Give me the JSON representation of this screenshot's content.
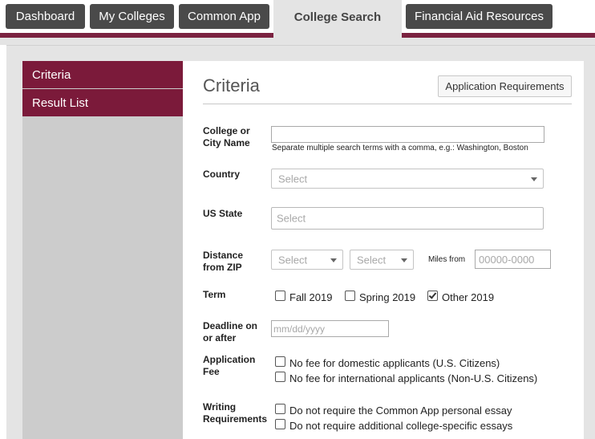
{
  "nav": {
    "tabs": [
      {
        "label": "Dashboard"
      },
      {
        "label": "My Colleges"
      },
      {
        "label": "Common App"
      },
      {
        "label": "College Search",
        "active": true
      },
      {
        "label": "Financial Aid Resources"
      }
    ]
  },
  "sidebar": {
    "items": [
      {
        "label": "Criteria"
      },
      {
        "label": "Result List"
      }
    ]
  },
  "main": {
    "title": "Criteria",
    "requirements_button": "Application Requirements",
    "college_name": {
      "label": "College or City Name",
      "value": "",
      "hint": "Separate multiple search terms with a comma, e.g.: Washington, Boston"
    },
    "country": {
      "label": "Country",
      "placeholder": "Select"
    },
    "us_state": {
      "label": "US State",
      "placeholder": "Select"
    },
    "distance": {
      "label": "Distance from ZIP",
      "select1_placeholder": "Select",
      "select2_placeholder": "Select",
      "miles_label": "Miles from",
      "zip_placeholder": "00000-0000"
    },
    "term": {
      "label": "Term",
      "options": [
        {
          "label": "Fall 2019",
          "checked": false
        },
        {
          "label": "Spring 2019",
          "checked": false
        },
        {
          "label": "Other 2019",
          "checked": true
        }
      ]
    },
    "deadline": {
      "label": "Deadline on or after",
      "placeholder": "mm/dd/yyyy"
    },
    "application_fee": {
      "label": "Application Fee",
      "options": [
        {
          "label": "No fee for domestic applicants (U.S. Citizens)",
          "checked": false
        },
        {
          "label": "No fee for international applicants (Non-U.S. Citizens)",
          "checked": false
        }
      ]
    },
    "writing": {
      "label": "Writing Requirements",
      "options": [
        {
          "label": "Do not require the Common App personal essay",
          "checked": false
        },
        {
          "label": "Do not require additional college-specific essays",
          "checked": false
        }
      ]
    }
  },
  "colors": {
    "brand": "#7b1a3a",
    "nav_tab": "#4a4a4a",
    "panel": "#e4e4e4"
  }
}
